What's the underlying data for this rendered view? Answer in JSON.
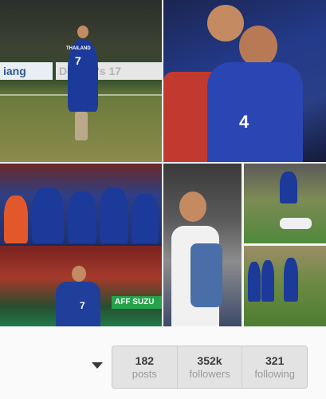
{
  "grid": {
    "post1": {
      "board_left": "iang",
      "board_right": "Donald's 17",
      "jersey_name": "THAILAND",
      "jersey_number": "7"
    },
    "post2": {
      "jersey_number": "4"
    },
    "post3": {
      "banner": "AFF SUZU",
      "jersey_number": "7"
    },
    "post4": {}
  },
  "profile_stats": {
    "posts": {
      "count": "182",
      "label": "posts"
    },
    "followers": {
      "count": "352k",
      "label": "followers"
    },
    "following": {
      "count": "321",
      "label": "following"
    }
  },
  "icons": {
    "menu_caret": "chevron-down-icon"
  }
}
